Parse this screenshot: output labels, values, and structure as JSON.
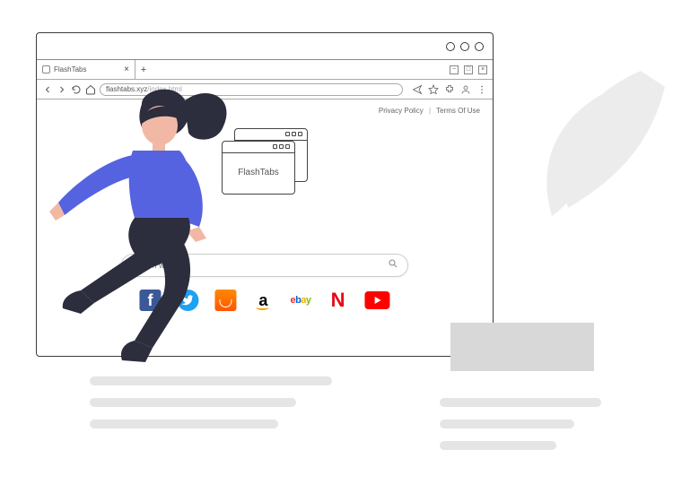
{
  "window": {
    "tab_title": "FlashTabs",
    "url_host": "flashtabs.xyz",
    "url_path": "/index.html"
  },
  "header_links": {
    "privacy": "Privacy Policy",
    "terms": "Terms Of Use"
  },
  "logo": {
    "text": "FlashTabs"
  },
  "search": {
    "placeholder": "Search web"
  },
  "quicklinks": [
    {
      "name": "facebook",
      "label": "f"
    },
    {
      "name": "twitter",
      "label": ""
    },
    {
      "name": "aliexpress",
      "label": ""
    },
    {
      "name": "amazon",
      "label": "a"
    },
    {
      "name": "ebay",
      "label": "ebay"
    },
    {
      "name": "netflix",
      "label": "N"
    },
    {
      "name": "youtube",
      "label": ""
    }
  ]
}
